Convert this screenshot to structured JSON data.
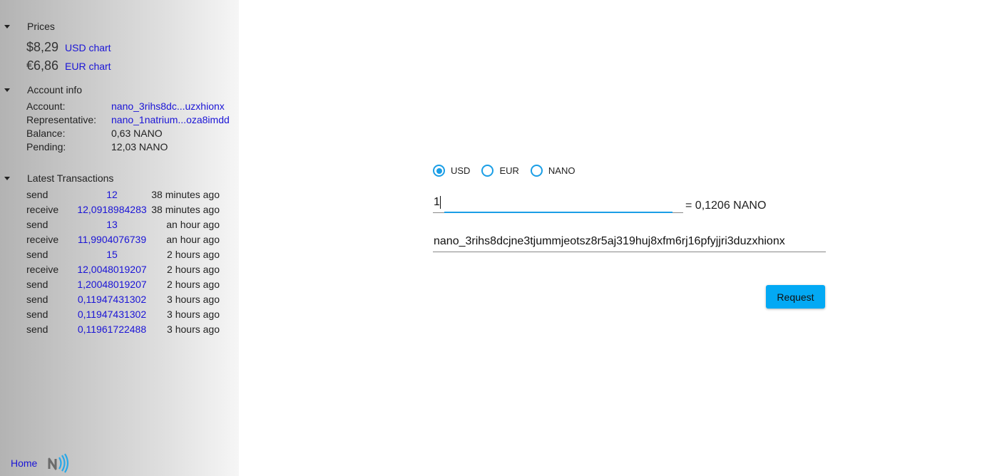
{
  "sidebar": {
    "prices": {
      "title": "Prices",
      "rows": [
        {
          "value": "$8,29",
          "link": "USD chart"
        },
        {
          "value": "€6,86",
          "link": "EUR chart"
        }
      ]
    },
    "account_info": {
      "title": "Account info",
      "rows": [
        {
          "label": "Account:",
          "value": "nano_3rihs8dc...uzxhionx"
        },
        {
          "label": "Representative:",
          "value": "nano_1natrium...oza8imdd"
        },
        {
          "label": "Balance:",
          "value": "0,63 NANO"
        },
        {
          "label": "Pending:",
          "value": "12,03 NANO"
        }
      ]
    },
    "transactions": {
      "title": "Latest Transactions",
      "rows": [
        {
          "type": "send",
          "amount": "12",
          "time": "38 minutes ago"
        },
        {
          "type": "receive",
          "amount": "12,0918984283",
          "time": "38 minutes ago"
        },
        {
          "type": "send",
          "amount": "13",
          "time": "an hour ago"
        },
        {
          "type": "receive",
          "amount": "11,9904076739",
          "time": "an hour ago"
        },
        {
          "type": "send",
          "amount": "15",
          "time": "2 hours ago"
        },
        {
          "type": "receive",
          "amount": "12,0048019207",
          "time": "2 hours ago"
        },
        {
          "type": "send",
          "amount": "1,20048019207",
          "time": "2 hours ago"
        },
        {
          "type": "send",
          "amount": "0,11947431302",
          "time": "3 hours ago"
        },
        {
          "type": "send",
          "amount": "0,11947431302",
          "time": "3 hours ago"
        },
        {
          "type": "send",
          "amount": "0,11961722488",
          "time": "3 hours ago"
        }
      ]
    },
    "footer": {
      "home_label": "Home",
      "logo_icon": "nano-logo-icon"
    }
  },
  "form": {
    "currency_options": [
      {
        "label": "USD",
        "checked": true
      },
      {
        "label": "EUR",
        "checked": false
      },
      {
        "label": "NANO",
        "checked": false
      }
    ],
    "amount_value": "1",
    "converted_text": "= 0,1206 NANO",
    "address_value": "nano_3rihs8dcjne3tjummjeotsz8r5aj319huj8xfm6rj16pfyjjri3duzxhionx",
    "request_label": "Request"
  },
  "colors": {
    "accent": "#03a9f4",
    "radio": "#1a9ee6",
    "link": "#1a14d6"
  }
}
